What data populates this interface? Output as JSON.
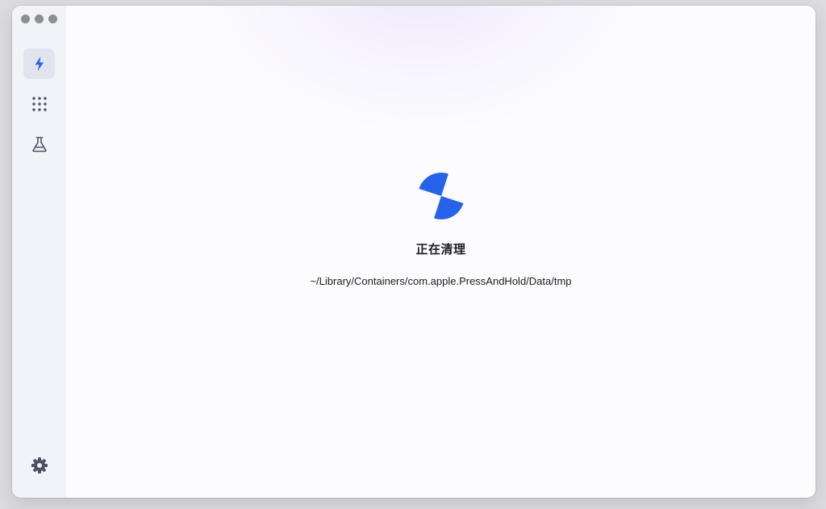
{
  "sidebar": {
    "items": [
      {
        "icon": "bolt-icon",
        "active": true
      },
      {
        "icon": "grid-dots-icon",
        "active": false
      },
      {
        "icon": "flask-icon",
        "active": false
      }
    ],
    "bottom": {
      "icon": "gear-icon"
    }
  },
  "main": {
    "status_title": "正在清理",
    "status_path": "~/Library/Containers/com.apple.PressAndHold/Data/tmp"
  },
  "colors": {
    "accent": "#2563eb",
    "icon_gray": "#4a5263",
    "sidebar_bg": "#f1f3f8"
  }
}
